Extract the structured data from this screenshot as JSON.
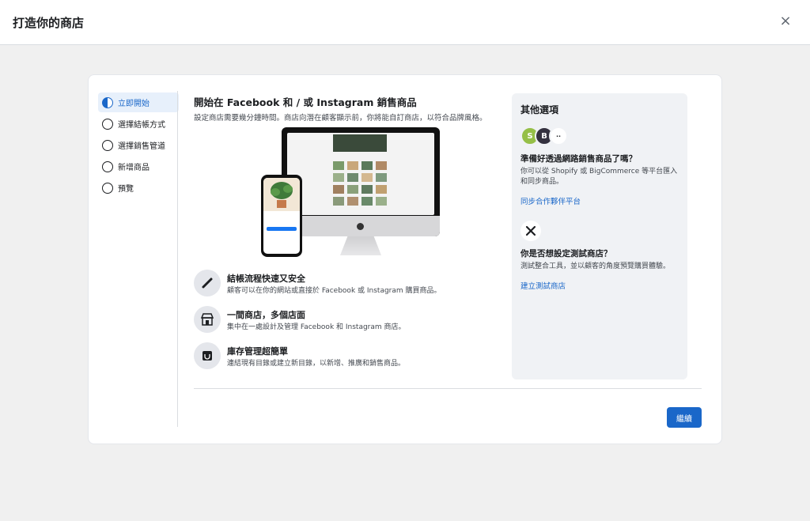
{
  "header": {
    "title": "打造你的商店",
    "close_glyph": "×"
  },
  "steps": [
    {
      "label": "立即開始",
      "active": true
    },
    {
      "label": "選擇結帳方式",
      "active": false
    },
    {
      "label": "選擇銷售管道",
      "active": false
    },
    {
      "label": "新增商品",
      "active": false
    },
    {
      "label": "預覽",
      "active": false
    }
  ],
  "main": {
    "title": "開始在 Facebook 和 / 或 Instagram 銷售商品",
    "subtitle": "設定商店需要幾分鐘時間。商店向潛在顧客顯示前，你將能自訂商店，以符合品牌風格。",
    "features": [
      {
        "icon": "card-icon",
        "title": "結帳流程快速又安全",
        "desc": "顧客可以在你的網站或直接於 Facebook 或 Instagram 購買商品。"
      },
      {
        "icon": "storefront-icon",
        "title": "一間商店，多個店面",
        "desc": "集中在一處設計及管理 Facebook 和 Instagram 商店。"
      },
      {
        "icon": "inventory-icon",
        "title": "庫存管理超簡單",
        "desc": "連結現有目錄或建立新目錄，以新增、推廣和銷售商品。"
      }
    ]
  },
  "side": {
    "title": "其他選項",
    "partner": {
      "title": "準備好透過網路銷售商品了嗎？",
      "desc": "你可以從 Shopify 或 BigCommerce 等平台匯入和同步商品。",
      "link": "同步合作夥伴平台"
    },
    "test": {
      "title": "你是否想設定測試商店？",
      "desc": "測試整合工具，並以顧客的角度預覽購買體驗。",
      "link": "建立測試商店"
    }
  },
  "footer": {
    "next_label": "繼續"
  },
  "colors": {
    "accent": "#1a67c9",
    "active_bg": "#e7f0fb"
  }
}
